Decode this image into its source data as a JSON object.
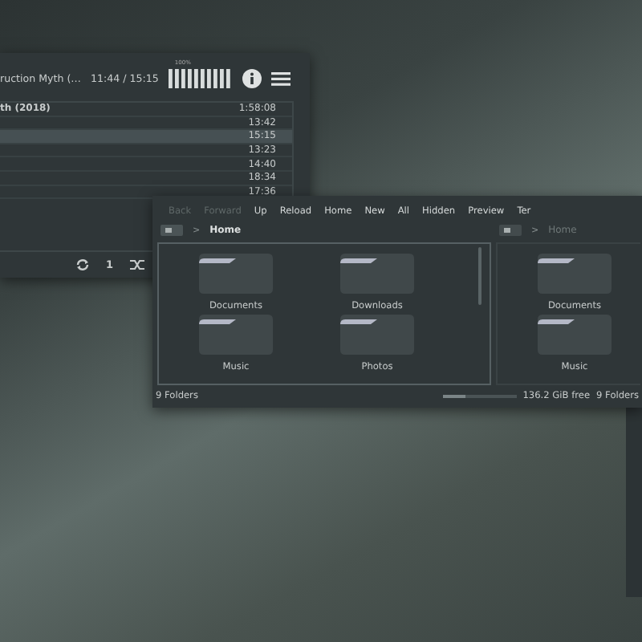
{
  "player": {
    "title": "ruction Myth (…",
    "time": "11:44 / 15:15",
    "volume_label": "100%",
    "volume": {
      "level": 1
    },
    "tracks": [
      {
        "title": "th (2018)",
        "duration": "1:58:08",
        "selected": false
      },
      {
        "duration": "13:42",
        "selected": false
      },
      {
        "duration": "15:15",
        "selected": true
      },
      {
        "duration": "13:23",
        "selected": false
      },
      {
        "duration": "14:40",
        "selected": false
      },
      {
        "duration": "18:34",
        "selected": false
      },
      {
        "duration": "17:36",
        "selected": false
      }
    ],
    "controls": [
      {
        "kind": "repeat"
      },
      {
        "kind": "text",
        "label": "1"
      },
      {
        "kind": "shuffle"
      }
    ]
  },
  "files": {
    "toolbar": [
      {
        "label": "Back",
        "disabled": true
      },
      {
        "label": "Forward",
        "disabled": true
      },
      {
        "label": "Up",
        "disabled": false
      },
      {
        "label": "Reload",
        "disabled": false
      },
      {
        "label": "Home",
        "disabled": false
      },
      {
        "label": "New",
        "disabled": false
      },
      {
        "label": "All",
        "disabled": false
      },
      {
        "label": "Hidden",
        "disabled": false
      },
      {
        "label": "Preview",
        "disabled": false
      },
      {
        "label": "Ter",
        "disabled": false
      }
    ],
    "panes": [
      {
        "separator": ">",
        "path": "Home",
        "active": true,
        "folders": [
          "Documents",
          "Downloads",
          "Music",
          "Photos"
        ]
      },
      {
        "separator": ">",
        "path": "Home",
        "active": false,
        "folders": [
          "Documents",
          "Music"
        ]
      }
    ],
    "status": {
      "left": "9 Folders",
      "disk": {
        "level": 0.3
      },
      "free": "136.2 GiB free",
      "right": "9 Folders"
    }
  }
}
